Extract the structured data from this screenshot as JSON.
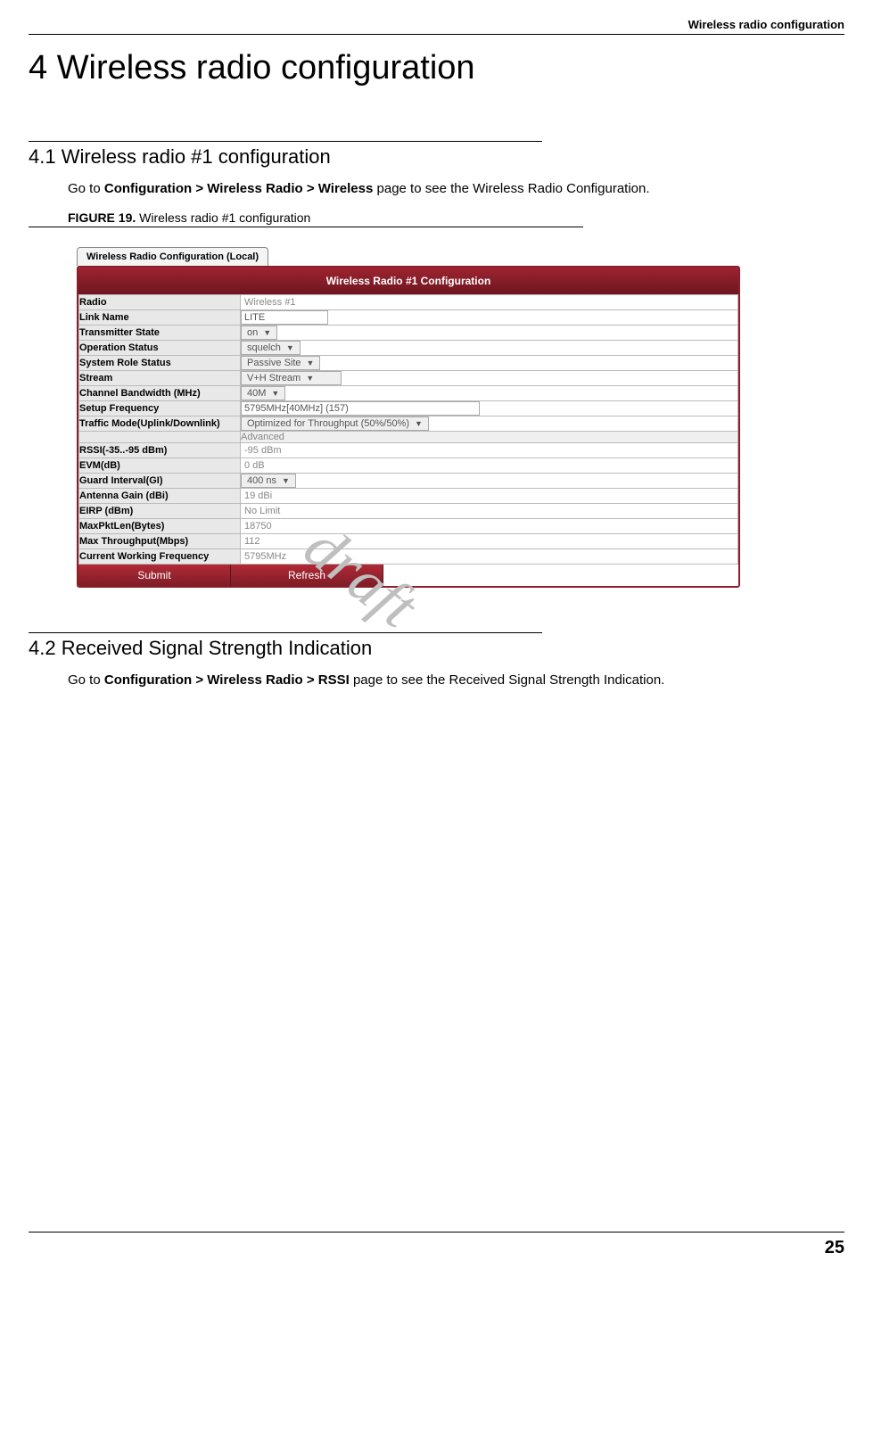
{
  "running_head": "Wireless radio configuration",
  "chapter_title": "4 Wireless radio configuration",
  "section41_title": "4.1 Wireless radio #1 configuration",
  "section41_body_pre": "Go to ",
  "section41_body_bold": "Configuration > Wireless Radio > Wireless",
  "section41_body_post": " page to see the Wireless Radio Configuration.",
  "fig19_label": "FIGURE 19.",
  "fig19_caption": " Wireless radio #1 configuration",
  "tab_label": "Wireless Radio Configuration (Local)",
  "panel_title": "Wireless Radio #1 Configuration",
  "rows": {
    "radio": {
      "label": "Radio",
      "value": "Wireless #1"
    },
    "linkname": {
      "label": "Link Name",
      "value": "LITE"
    },
    "txstate": {
      "label": "Transmitter State",
      "value": "on"
    },
    "opstatus": {
      "label": "Operation Status",
      "value": "squelch"
    },
    "role": {
      "label": "System Role Status",
      "value": "Passive Site"
    },
    "stream": {
      "label": "Stream",
      "value": "V+H Stream"
    },
    "bw": {
      "label": "Channel Bandwidth (MHz)",
      "value": "40M"
    },
    "freq": {
      "label": "Setup Frequency",
      "value": "5795MHz[40MHz] (157)"
    },
    "traffic": {
      "label": "Traffic Mode(Uplink/Downlink)",
      "value": "Optimized for Throughput (50%/50%)"
    },
    "advanced": "Advanced",
    "rssi": {
      "label": "RSSI(-35..-95 dBm)",
      "value": "-95 dBm"
    },
    "evm": {
      "label": "EVM(dB)",
      "value": "0 dB"
    },
    "gi": {
      "label": "Guard Interval(GI)",
      "value": "400 ns"
    },
    "gain": {
      "label": "Antenna Gain (dBi)",
      "value": "19 dBi"
    },
    "eirp": {
      "label": "EIRP (dBm)",
      "value": "No Limit"
    },
    "maxpkt": {
      "label": "MaxPktLen(Bytes)",
      "value": "18750"
    },
    "maxtp": {
      "label": "Max Throughput(Mbps)",
      "value": "112"
    },
    "cwf": {
      "label": "Current Working Frequency",
      "value": "5795MHz"
    }
  },
  "btn_submit": "Submit",
  "btn_refresh": "Refresh",
  "watermark": "draft",
  "section42_title": "4.2 Received Signal Strength Indication",
  "section42_body_pre": "Go to ",
  "section42_body_bold": "Configuration > Wireless Radio > RSSI",
  "section42_body_post": " page to see the Received Signal Strength Indication.",
  "page_number": "25"
}
